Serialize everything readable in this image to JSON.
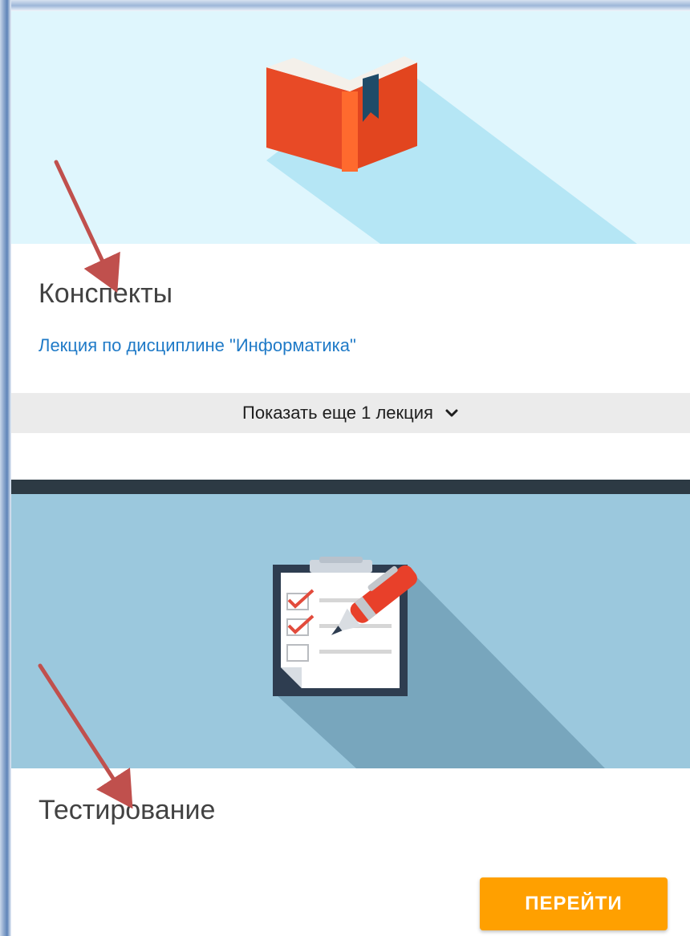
{
  "notes_card": {
    "title": "Конспекты",
    "lecture_link": "Лекция по дисциплине \"Информатика\"",
    "show_more_label": "Показать еще 1 лекция"
  },
  "testing_card": {
    "title": "Тестирование",
    "go_button_label": "ПЕРЕЙТИ"
  },
  "colors": {
    "notes_hero_bg": "#dff6fd",
    "testing_hero_bg": "#9bc8dd",
    "link": "#1f7ac7",
    "button": "#ffa000",
    "annotation_arrow": "#c0504d"
  },
  "icons": [
    "book-icon",
    "clipboard-checklist-icon",
    "chevron-down-icon",
    "annotation-arrow"
  ]
}
